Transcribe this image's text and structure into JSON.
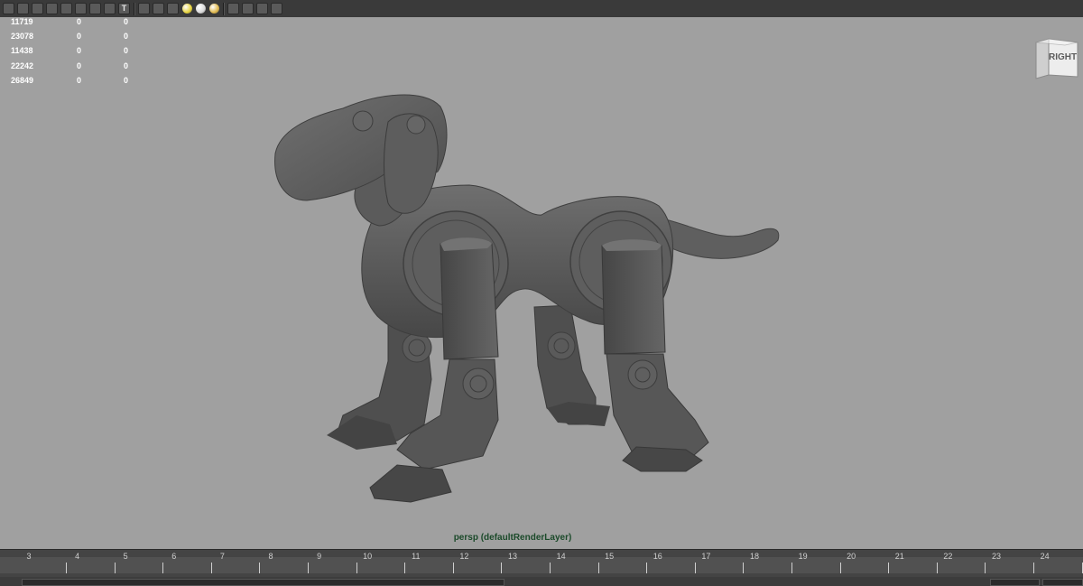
{
  "toolbar": {
    "buttons": [
      {
        "name": "select-tool-icon",
        "glyph": ""
      },
      {
        "name": "lasso-icon",
        "glyph": ""
      },
      {
        "name": "wireframe-icon",
        "glyph": ""
      },
      {
        "name": "smooth-shade-icon",
        "glyph": ""
      },
      {
        "name": "shade-options-icon",
        "glyph": ""
      },
      {
        "name": "flat-shade-icon",
        "glyph": ""
      },
      {
        "name": "bounding-box-icon",
        "glyph": ""
      },
      {
        "name": "texture-icon",
        "glyph": ""
      },
      {
        "name": "text-icon",
        "glyph": "T"
      }
    ],
    "buttons2": [
      {
        "name": "cube-wire-icon"
      },
      {
        "name": "cube-shaded-icon"
      },
      {
        "name": "checker-icon"
      }
    ],
    "lights": [
      "#e6d23a",
      "#d8d8d8",
      "#e0b84a"
    ],
    "buttons3": [
      {
        "name": "isolate-select-icon"
      },
      {
        "name": "xray-icon"
      },
      {
        "name": "grid-icon"
      },
      {
        "name": "share-icon"
      }
    ]
  },
  "hud": {
    "rows": [
      [
        "11719",
        "0",
        "0"
      ],
      [
        "23078",
        "0",
        "0"
      ],
      [
        "11438",
        "0",
        "0"
      ],
      [
        "22242",
        "0",
        "0"
      ],
      [
        "26849",
        "0",
        "0"
      ]
    ]
  },
  "viewcube": {
    "label": "RIGHT"
  },
  "camera": {
    "label": "persp (defaultRenderLayer)"
  },
  "timeline": {
    "frames": [
      "3",
      "4",
      "5",
      "6",
      "7",
      "8",
      "9",
      "10",
      "11",
      "12",
      "13",
      "14",
      "15",
      "16",
      "17",
      "18",
      "19",
      "20",
      "21",
      "22",
      "23",
      "24"
    ]
  }
}
